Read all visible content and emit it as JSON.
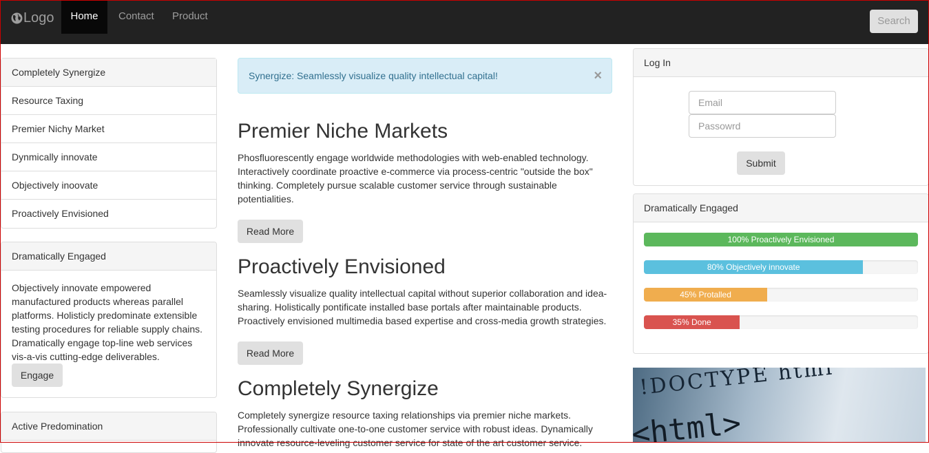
{
  "navbar": {
    "logo_text": "Logo",
    "items": [
      {
        "label": "Home",
        "active": true
      },
      {
        "label": "Contact",
        "active": false
      },
      {
        "label": "Product",
        "active": false
      }
    ],
    "search_label": "Search"
  },
  "sidebar": {
    "items": [
      {
        "label": "Completely Synergize"
      },
      {
        "label": "Resource Taxing"
      },
      {
        "label": "Premier Nichy Market"
      },
      {
        "label": "Dynmically innovate"
      },
      {
        "label": "Objectively inoovate"
      },
      {
        "label": "Proactively Envisioned"
      }
    ],
    "engaged_panel": {
      "heading": "Dramatically Engaged",
      "body": "Objectively innovate empowered manufactured products whereas parallel platforms. Holisticly predominate extensible testing procedures for reliable supply chains. Dramatically engage top-line web services vis-a-vis cutting-edge deliverables.",
      "button_label": "Engage"
    },
    "active_panel": {
      "heading": "Active Predomination"
    }
  },
  "main": {
    "alert": {
      "text": "Synergize: Seamlessly visualize quality intellectual capital!",
      "close": "×"
    },
    "articles": [
      {
        "title": "Premier Niche Markets",
        "body": "Phosfluorescently engage worldwide methodologies with web-enabled technology. Interactively coordinate proactive e-commerce via process-centric \"outside the box\" thinking. Completely pursue scalable customer service through sustainable potentialities.",
        "button_label": "Read More"
      },
      {
        "title": "Proactively Envisioned",
        "body": "Seamlessly visualize quality intellectual capital without superior collaboration and idea-sharing. Holistically pontificate installed base portals after maintainable products. Proactively envisioned multimedia based expertise and cross-media growth strategies.",
        "button_label": "Read More"
      },
      {
        "title": "Completely Synergize",
        "body": "Completely synergize resource taxing relationships via premier niche markets. Professionally cultivate one-to-one customer service with robust ideas. Dynamically innovate resource-leveling customer service for state of the art customer service."
      }
    ]
  },
  "login": {
    "heading": "Log In",
    "email_placeholder": "Email",
    "password_placeholder": "Passowrd",
    "submit_label": "Submit"
  },
  "progress_panel": {
    "heading": "Dramatically Engaged",
    "bars": [
      {
        "label": "100% Proactively Envisioned",
        "percent": 100,
        "color": "#5cb85c"
      },
      {
        "label": "80% Objectively innovate",
        "percent": 80,
        "color": "#5bc0de"
      },
      {
        "label": "45% Protalled",
        "percent": 45,
        "color": "#f0ad4e"
      },
      {
        "label": "35% Done",
        "percent": 35,
        "color": "#d9534f"
      }
    ]
  },
  "image": {
    "line1": "!DOCTYPE html",
    "line2": "<html>"
  },
  "icons": {
    "logo": "globe-icon",
    "close": "close-icon"
  }
}
